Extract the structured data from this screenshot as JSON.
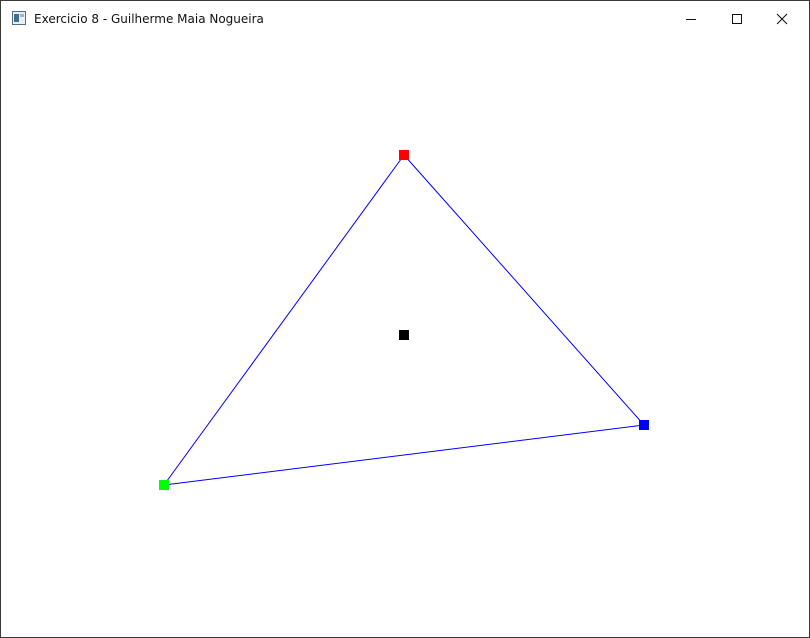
{
  "window": {
    "title": "Exercicio 8 - Guilherme Maia Nogueira",
    "icon": "application-window-icon",
    "controls": [
      "minimize-icon",
      "maximize-icon",
      "close-icon"
    ]
  },
  "canvas": {
    "background": "#ffffff",
    "edge_color": "#0000ff",
    "vertices": [
      {
        "name": "top",
        "color": "#ff0000"
      },
      {
        "name": "right",
        "color": "#0000ff"
      },
      {
        "name": "left",
        "color": "#00ff00"
      }
    ],
    "center_marker": {
      "color": "#000000"
    }
  }
}
